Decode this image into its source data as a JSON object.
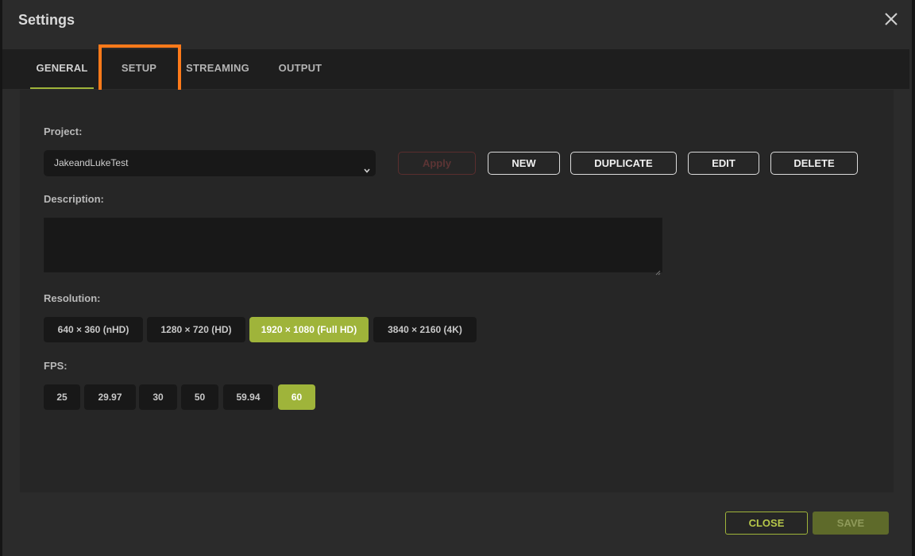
{
  "dialog": {
    "title": "Settings",
    "close_icon": "close-icon"
  },
  "tabs": [
    {
      "label": "GENERAL",
      "active": true
    },
    {
      "label": "SETUP",
      "active": false,
      "highlighted": true
    },
    {
      "label": "STREAMING",
      "active": false
    },
    {
      "label": "OUTPUT",
      "active": false
    }
  ],
  "project": {
    "label": "Project:",
    "selected": "JakeandLukeTest",
    "apply_label": "Apply",
    "new_label": "NEW",
    "duplicate_label": "DUPLICATE",
    "edit_label": "EDIT",
    "delete_label": "DELETE"
  },
  "description": {
    "label": "Description:",
    "value": ""
  },
  "resolution": {
    "label": "Resolution:",
    "options": [
      "640 × 360 (nHD)",
      "1280 × 720 (HD)",
      "1920 × 1080 (Full HD)",
      "3840 × 2160 (4K)"
    ],
    "selected": "1920 × 1080 (Full HD)"
  },
  "fps": {
    "label": "FPS:",
    "options": [
      "25",
      "29.97",
      "30",
      "50",
      "59.94",
      "60"
    ],
    "selected": "60"
  },
  "footer": {
    "close_label": "CLOSE",
    "save_label": "SAVE"
  },
  "colors": {
    "accent": "#9fb43a",
    "highlight": "#ff7a1a",
    "background": "#2b2b2b"
  }
}
